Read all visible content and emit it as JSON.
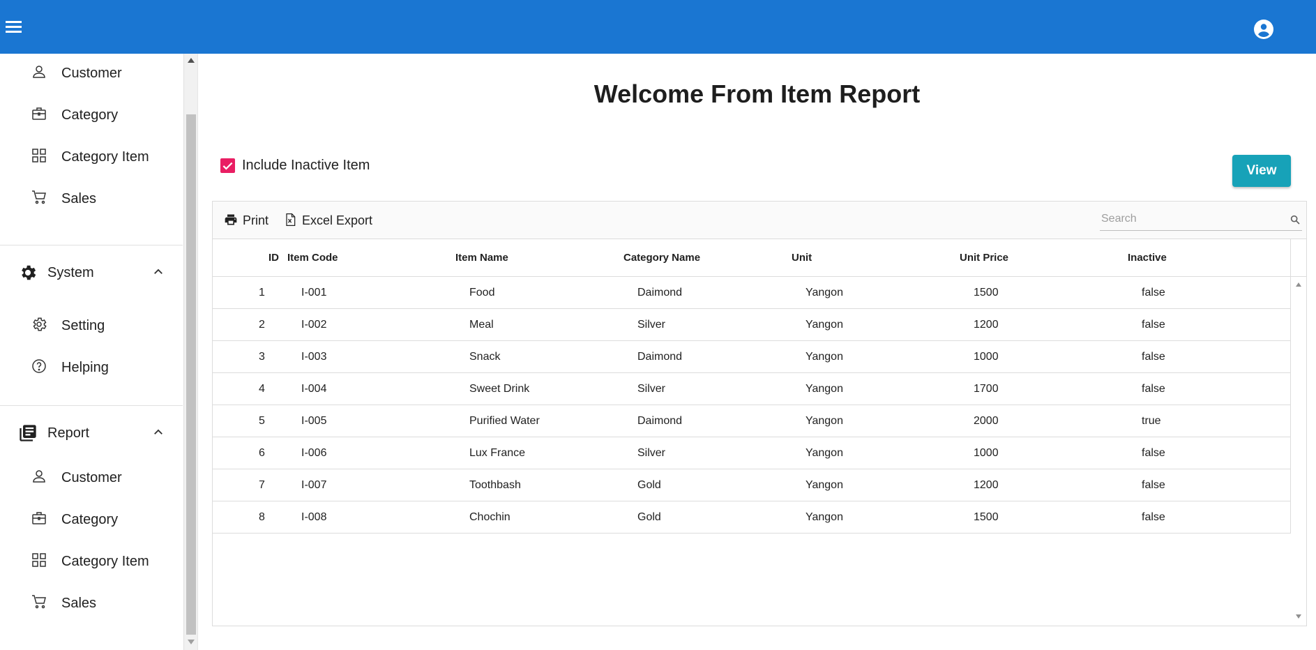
{
  "header": {
    "menu_icon": "hamburger-menu-icon",
    "account_icon": "account-circle-icon",
    "bg_color": "#1a76d2"
  },
  "sidebar": {
    "top_items": [
      {
        "label": "Customer",
        "icon": "person-icon"
      },
      {
        "label": "Category",
        "icon": "briefcase-icon"
      },
      {
        "label": "Category Item",
        "icon": "grid-icon"
      },
      {
        "label": "Sales",
        "icon": "cart-icon"
      }
    ],
    "system_group": {
      "label": "System",
      "icon": "gear-icon",
      "expanded": true,
      "items": [
        {
          "label": "Setting",
          "icon": "settings-icon"
        },
        {
          "label": "Helping",
          "icon": "help-icon"
        }
      ]
    },
    "report_group": {
      "label": "Report",
      "icon": "report-icon",
      "expanded": true,
      "items": [
        {
          "label": "Customer",
          "icon": "person-icon"
        },
        {
          "label": "Category",
          "icon": "briefcase-icon"
        },
        {
          "label": "Category Item",
          "icon": "grid-icon"
        },
        {
          "label": "Sales",
          "icon": "cart-icon"
        }
      ]
    }
  },
  "main": {
    "title": "Welcome From Item Report",
    "include_inactive": {
      "label": "Include Inactive Item",
      "checked": true,
      "color": "#e91e63"
    },
    "view_button": {
      "label": "View",
      "color": "#17a2b8"
    }
  },
  "grid": {
    "toolbar": {
      "print_label": "Print",
      "excel_label": "Excel Export",
      "search_placeholder": "Search"
    },
    "columns": [
      "ID",
      "Item Code",
      "Item Name",
      "Category Name",
      "Unit",
      "Unit Price",
      "Inactive"
    ],
    "rows": [
      [
        "1",
        "I-001",
        "Food",
        "Daimond",
        "Yangon",
        "1500",
        "false"
      ],
      [
        "2",
        "I-002",
        "Meal",
        "Silver",
        "Yangon",
        "1200",
        "false"
      ],
      [
        "3",
        "I-003",
        "Snack",
        "Daimond",
        "Yangon",
        "1000",
        "false"
      ],
      [
        "4",
        "I-004",
        "Sweet Drink",
        "Silver",
        "Yangon",
        "1700",
        "false"
      ],
      [
        "5",
        "I-005",
        "Purified Water",
        "Daimond",
        "Yangon",
        "2000",
        "true"
      ],
      [
        "6",
        "I-006",
        "Lux France",
        "Silver",
        "Yangon",
        "1000",
        "false"
      ],
      [
        "7",
        "I-007",
        "Toothbash",
        "Gold",
        "Yangon",
        "1200",
        "false"
      ],
      [
        "8",
        "I-008",
        "Chochin",
        "Gold",
        "Yangon",
        "1500",
        "false"
      ]
    ]
  }
}
